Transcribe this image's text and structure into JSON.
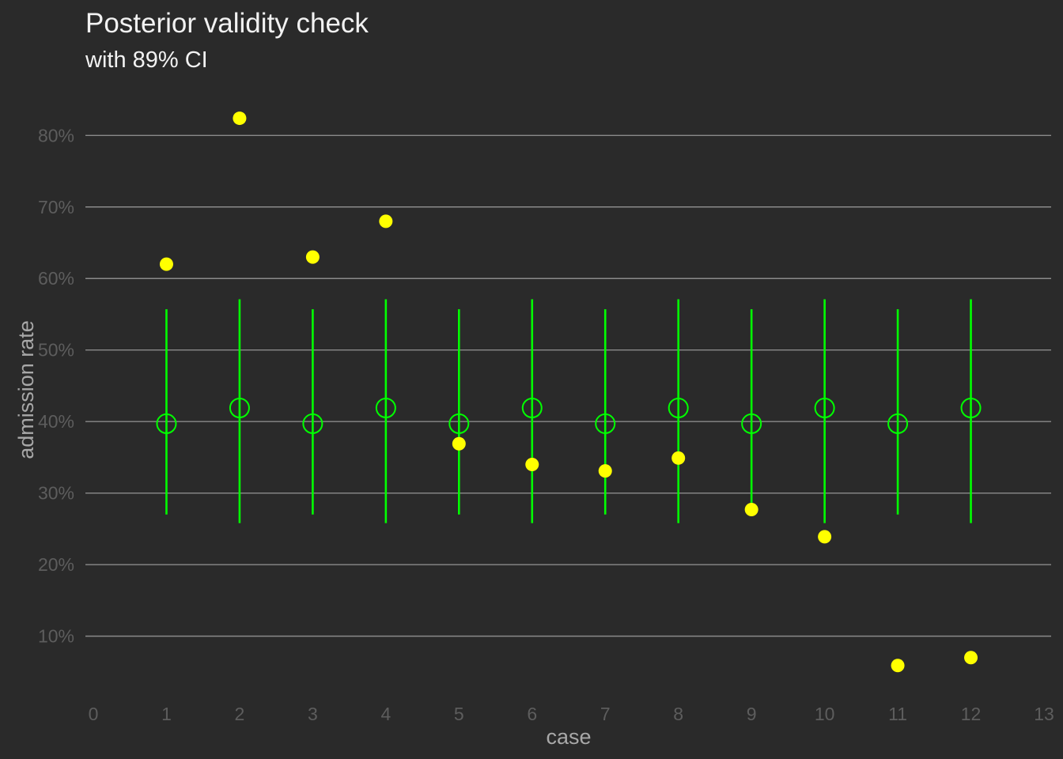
{
  "chart_data": {
    "type": "scatter",
    "title": "Posterior validity check",
    "subtitle": "with 89% CI",
    "xlabel": "case",
    "ylabel": "admission rate",
    "xlim": [
      0,
      13
    ],
    "ylim": [
      0.02,
      0.86
    ],
    "x_ticks": [
      "0",
      "1",
      "2",
      "3",
      "4",
      "5",
      "6",
      "7",
      "8",
      "9",
      "10",
      "11",
      "12",
      "13"
    ],
    "x_tick_values": [
      0,
      1,
      2,
      3,
      4,
      5,
      6,
      7,
      8,
      9,
      10,
      11,
      12,
      13
    ],
    "y_ticks": [
      "10%",
      "20%",
      "30%",
      "40%",
      "50%",
      "60%",
      "70%",
      "80%"
    ],
    "y_tick_values": [
      0.1,
      0.2,
      0.3,
      0.4,
      0.5,
      0.6,
      0.7,
      0.8
    ],
    "grid": "horizontal",
    "observed": {
      "color": "#ffff00",
      "x": [
        1,
        2,
        3,
        4,
        5,
        6,
        7,
        8,
        9,
        10,
        11,
        12
      ],
      "y": [
        0.62,
        0.824,
        0.63,
        0.68,
        0.369,
        0.34,
        0.331,
        0.349,
        0.277,
        0.239,
        0.059,
        0.07
      ]
    },
    "posterior": {
      "color": "#00ff00",
      "x": [
        1,
        2,
        3,
        4,
        5,
        6,
        7,
        8,
        9,
        10,
        11,
        12
      ],
      "mean": [
        0.397,
        0.419,
        0.397,
        0.419,
        0.397,
        0.419,
        0.397,
        0.419,
        0.397,
        0.419,
        0.397,
        0.419
      ],
      "lower": [
        0.27,
        0.258,
        0.27,
        0.258,
        0.27,
        0.258,
        0.27,
        0.258,
        0.27,
        0.258,
        0.27,
        0.258
      ],
      "upper": [
        0.557,
        0.571,
        0.557,
        0.571,
        0.557,
        0.571,
        0.557,
        0.571,
        0.557,
        0.571,
        0.557,
        0.571
      ]
    }
  }
}
